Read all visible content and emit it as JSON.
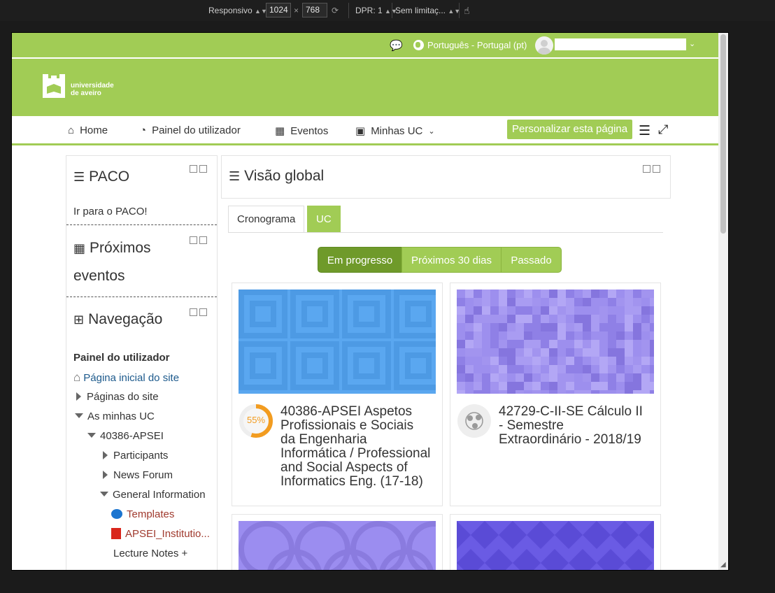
{
  "devtools": {
    "device": "Responsivo",
    "width": "1024",
    "times": "×",
    "height": "768",
    "dpr": "DPR: 1",
    "throttle": "Sem limitaç..."
  },
  "topbar": {
    "language": "Português - Portugal (pt)"
  },
  "brand": {
    "line1": "universidade",
    "line2": "de aveiro"
  },
  "nav": {
    "home": "Home",
    "dashboard": "Painel do utilizador",
    "events": "Eventos",
    "courses": "Minhas UC",
    "customize": "Personalizar esta página"
  },
  "blocks": {
    "paco_title": "PACO",
    "paco_link": "Ir para o PACO!",
    "events_title_1": "Próximos",
    "events_title_2": "eventos",
    "nav_title": "Navegação"
  },
  "tree": {
    "dashboard": "Painel do utilizador",
    "site_home": "Página inicial do site",
    "site_pages": "Páginas do site",
    "my_courses": "As minhas UC",
    "course": "40386-APSEI",
    "participants": "Participants",
    "news": "News Forum",
    "general": "General Information",
    "templates": "Templates",
    "apsei_file": "APSEI_Institutio...",
    "lecture": "Lecture Notes +"
  },
  "overview": {
    "title": "Visão global",
    "tab_timeline": "Cronograma",
    "tab_courses": "UC",
    "seg_inprogress": "Em progresso",
    "seg_next30": "Próximos 30 dias",
    "seg_past": "Passado"
  },
  "courses": [
    {
      "title": "40386-APSEI Aspetos Profissionais e Sociais da Engenharia Informática / Professional and Social Aspects of Informatics Eng. (17-18)",
      "progress_label": "55%",
      "progress": 0.55
    },
    {
      "title": "42729-C-II-SE Cálculo II - Semestre Extraordinário - 2018/19"
    }
  ],
  "colors": {
    "accent": "#a1cc55",
    "accent_dark": "#6f9a2a",
    "progress": "#f29c20"
  }
}
